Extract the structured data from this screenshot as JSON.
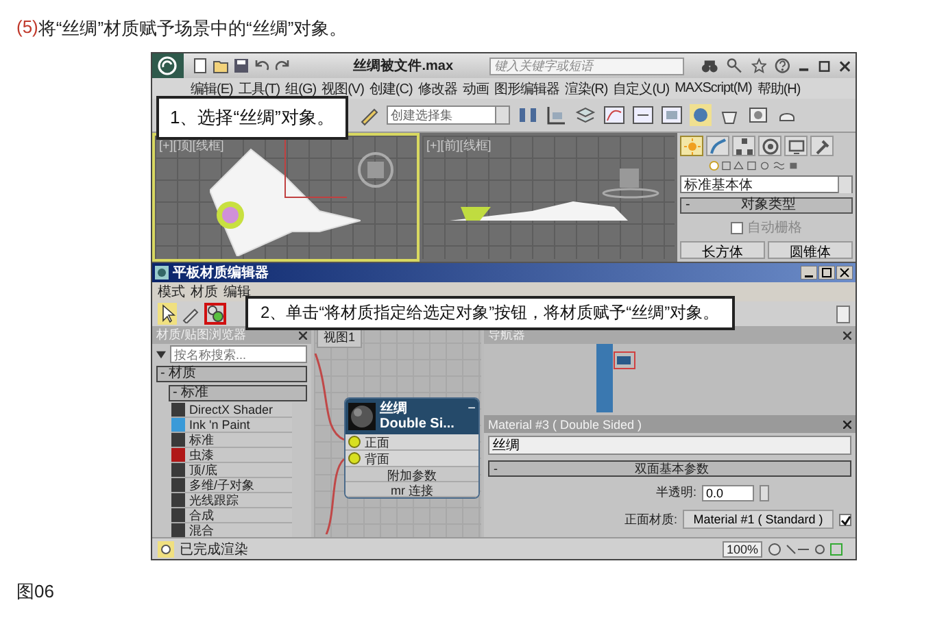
{
  "heading": {
    "number": "(5)",
    "text": "将“丝绸”材质赋予场景中的“丝绸”对象。"
  },
  "max_window": {
    "title": "丝绸被文件.max",
    "search": {
      "placeholder": "键入关键字或短语"
    },
    "menu": [
      "编辑(E)",
      "工具(T)",
      "组(G)",
      "视图(V)",
      "创建(C)",
      "修改器",
      "动画",
      "图形编辑器",
      "渲染(R)",
      "自定义(U)",
      "MAXScript(M)",
      "帮助(H)"
    ],
    "toolbar": {
      "selection_set": "创建选择集"
    },
    "viewports": [
      {
        "label": "[+][顶][线框]",
        "active": true,
        "kind": "top"
      },
      {
        "label": "[+][前][线框]",
        "active": false,
        "kind": "front"
      }
    ],
    "command_panel": {
      "tabs": [
        {
          "selected": true
        },
        {
          "selected": false
        },
        {
          "selected": false
        },
        {
          "selected": false
        },
        {
          "selected": false
        },
        {
          "selected": false
        }
      ],
      "category": "标准基本体",
      "rollout": {
        "sign": "-",
        "title": "对象类型"
      },
      "autogrid": {
        "label": "自动栅格",
        "checked": false
      },
      "buttons": [
        "长方体",
        "圆锥体"
      ]
    }
  },
  "material_editor": {
    "title": "平板材质编辑器",
    "menu": [
      "模式",
      "材质",
      "编辑"
    ],
    "assign_button": {
      "highlighted": true
    },
    "browser": {
      "title": "材质/贴图浏览器",
      "search": {
        "placeholder": "按名称搜索..."
      },
      "groups": [
        "- 材质",
        "- 标准"
      ],
      "items": [
        {
          "name": "DirectX Shader",
          "color": "#3a3a3a"
        },
        {
          "name": "Ink 'n Paint",
          "color": "#3a9ad8"
        },
        {
          "name": "标准",
          "color": "#3a3a3a"
        },
        {
          "name": "虫漆",
          "color": "#b01818"
        },
        {
          "name": "顶/底",
          "color": "#3a3a3a"
        },
        {
          "name": "多维/子对象",
          "color": "#3a3a3a"
        },
        {
          "name": "光线跟踪",
          "color": "#3a3a3a"
        },
        {
          "name": "合成",
          "color": "#3a3a3a"
        },
        {
          "name": "混合",
          "color": "#3a3a3a"
        }
      ]
    },
    "view_tab": "视图1",
    "node": {
      "name": "丝绸",
      "type": "Double Si...",
      "collapse": "−",
      "slots": [
        "正面",
        "背面"
      ],
      "rollouts": [
        "附加参数",
        "mr 连接"
      ]
    },
    "navigator_title": "导航器",
    "params": {
      "title": "Material #3 ( Double Sided )",
      "name": "丝绸",
      "rollout": {
        "sign": "-",
        "title": "双面基本参数"
      },
      "translucency": {
        "label": "半透明:",
        "value": "0.0"
      },
      "facing": {
        "label": "正面材质:",
        "value": "Material #1 ( Standard )",
        "checked": true
      }
    },
    "status": "已完成渲染",
    "zoom": "100%"
  },
  "callouts": [
    {
      "text": "1、选择“丝绸”对象。",
      "kind": "select"
    },
    {
      "text": "2、单击“将材质指定给选定对象”按钮，将材质赋予“丝绸”对象。",
      "kind": "assign"
    }
  ],
  "caption": "图06"
}
